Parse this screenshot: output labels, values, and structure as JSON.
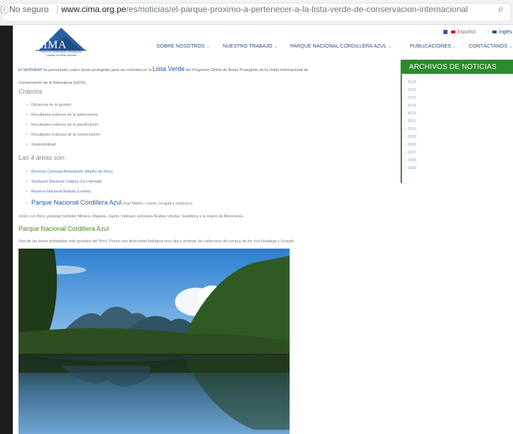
{
  "browser": {
    "security_text": "No seguro",
    "url_host": "www.cima.org.pe",
    "url_path": "/es/noticias/el-parque-proximo-a-pertenecer-a-la-lista-verde-de-conservacion-internacional"
  },
  "logo": {
    "text": "CIMA",
    "subtitle_1": "Centro de Conservación, Investigación",
    "subtitle_2": "y Manejo de Áreas Naturales"
  },
  "lang": {
    "es": "Español",
    "en": "Inglés"
  },
  "nav": {
    "items": [
      {
        "label": "SOBRE NOSOTROS",
        "caret": "⌄"
      },
      {
        "label": "NUESTRO TRABAJO",
        "caret": "⌄"
      },
      {
        "label": "PARQUE NACIONAL CORDILLERA AZUL",
        "caret": "⌄"
      },
      {
        "label": "PUBLICACIONES",
        "caret": "⌄"
      },
      {
        "label": "CONTÁCTANOS",
        "caret": "⌄"
      }
    ]
  },
  "content": {
    "intro_part1": "El SERNANP",
    "intro_part2": " ha presentado cuatro áreas protegidas para ser incluidas en la ",
    "intro_link": "Lista Verde",
    "intro_part3": " del Programa Global de Áreas Protegidas de la Unión Internacional de",
    "intro_line2": "Conservación de la Naturaleza (UICN).",
    "criterios_heading": "Criterios",
    "criterios": [
      "Eficiencia de la gestión",
      "Resultados exitosos de la gobernanza",
      "Resultados exitosos de la planificación",
      "Resultados exitosos de la conservación",
      "Sostenibilidad"
    ],
    "areas_heading": "Las 4 áreas son:",
    "areas": [
      {
        "name": "Reserva Comunal Amarakaeri (Madre de Dios)"
      },
      {
        "name": "Santuario Nacional Calipuy (La Libertad)"
      },
      {
        "name": "Reserva Nacional Matsés (Loreto)"
      },
      {
        "name": "Parque Nacional Cordillera Azul",
        "suffix": " (San Martín, Loreto, Ucayali y Huánuco)"
      }
    ],
    "junto": "Junto con Perú, postulan también México,  Malasia, Japón, Vietnam, Emiratos Árabes Unidos, Sudáfrica y la región de Micronesia.",
    "pnca_heading": "Parque Nacional Cordillera Azul",
    "pnca_text": "Una de las áreas protegidas más grandes del Perú. Posee una diversidad biológica muy alta y protege las cabeceras de cuenca de los ríos Huallaga y Ucayali."
  },
  "archive": {
    "title": "ARCHIVOS DE NOTICIAS",
    "years": [
      "2018",
      "2016",
      "2015",
      "2014",
      "2013",
      "2012",
      "2010",
      "2009",
      "2008",
      "2007",
      "2006",
      "1999"
    ]
  },
  "colors": {
    "archive_green": "#2d8a2d",
    "link_blue": "#2a5fa0",
    "heading_green": "#4a8a2a"
  }
}
